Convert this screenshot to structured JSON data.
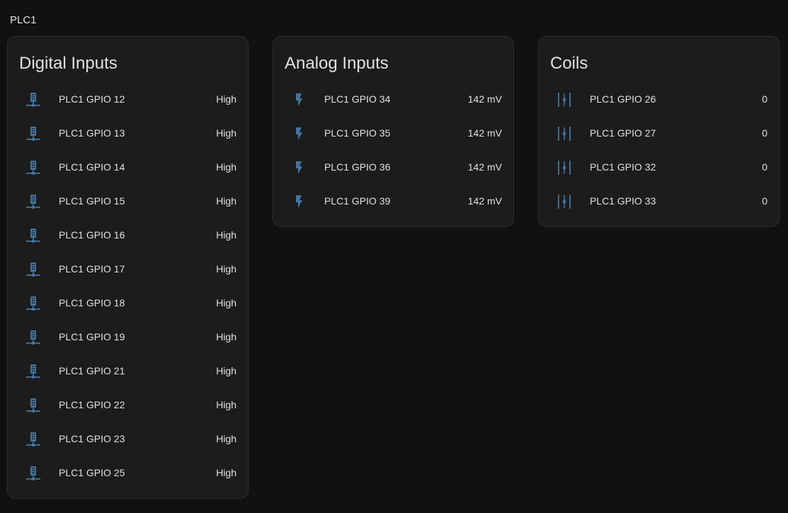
{
  "page": {
    "title": "PLC1"
  },
  "colors": {
    "icon": "#44739e",
    "background": "#111111",
    "card": "#1c1c1c"
  },
  "cards": [
    {
      "title": "Digital Inputs",
      "icon": "server-network-icon",
      "rows": [
        {
          "name": "PLC1 GPIO 12",
          "state": "High"
        },
        {
          "name": "PLC1 GPIO 13",
          "state": "High"
        },
        {
          "name": "PLC1 GPIO 14",
          "state": "High"
        },
        {
          "name": "PLC1 GPIO 15",
          "state": "High"
        },
        {
          "name": "PLC1 GPIO 16",
          "state": "High"
        },
        {
          "name": "PLC1 GPIO 17",
          "state": "High"
        },
        {
          "name": "PLC1 GPIO 18",
          "state": "High"
        },
        {
          "name": "PLC1 GPIO 19",
          "state": "High"
        },
        {
          "name": "PLC1 GPIO 21",
          "state": "High"
        },
        {
          "name": "PLC1 GPIO 22",
          "state": "High"
        },
        {
          "name": "PLC1 GPIO 23",
          "state": "High"
        },
        {
          "name": "PLC1 GPIO 25",
          "state": "High"
        }
      ]
    },
    {
      "title": "Analog Inputs",
      "icon": "flash-icon",
      "rows": [
        {
          "name": "PLC1 GPIO 34",
          "state": "142 mV"
        },
        {
          "name": "PLC1 GPIO 35",
          "state": "142 mV"
        },
        {
          "name": "PLC1 GPIO 36",
          "state": "142 mV"
        },
        {
          "name": "PLC1 GPIO 39",
          "state": "142 mV"
        }
      ]
    },
    {
      "title": "Coils",
      "icon": "coil-icon",
      "rows": [
        {
          "name": "PLC1 GPIO 26",
          "state": "0"
        },
        {
          "name": "PLC1 GPIO 27",
          "state": "0"
        },
        {
          "name": "PLC1 GPIO 32",
          "state": "0"
        },
        {
          "name": "PLC1 GPIO 33",
          "state": "0"
        }
      ]
    }
  ]
}
